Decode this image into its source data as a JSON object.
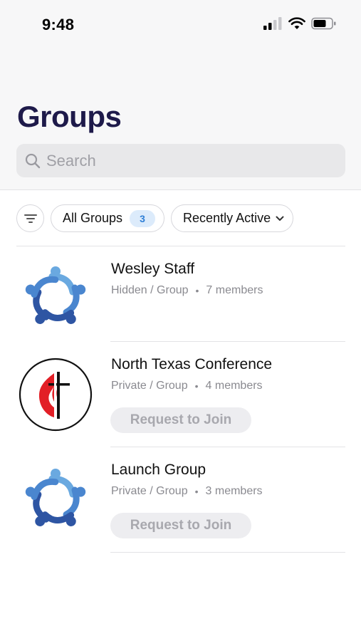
{
  "status_bar": {
    "time": "9:48"
  },
  "header": {
    "title": "Groups"
  },
  "search": {
    "placeholder": "Search",
    "icon": "search-icon"
  },
  "filters": {
    "filter_icon": "filter-icon",
    "all_groups": {
      "label": "All Groups",
      "count": "3"
    },
    "sort": {
      "label": "Recently Active",
      "icon": "chevron-down-icon"
    }
  },
  "groups": [
    {
      "name": "Wesley Staff",
      "visibility": "Hidden / Group",
      "members": "7 members",
      "logo": "people-circle-logo",
      "action": ""
    },
    {
      "name": "North Texas Conference",
      "visibility": "Private / Group",
      "members": "4 members",
      "logo": "cross-and-flame-logo",
      "action": "Request to Join"
    },
    {
      "name": "Launch Group",
      "visibility": "Private / Group",
      "members": "3 members",
      "logo": "people-circle-logo",
      "action": "Request to Join"
    }
  ],
  "colors": {
    "title": "#1e1a4a",
    "badge_bg": "#dcebfb",
    "badge_text": "#2f7fd6",
    "logo_light_blue": "#6aa9e0",
    "logo_dark_blue": "#2e55a3",
    "flame_red": "#e21f26"
  }
}
